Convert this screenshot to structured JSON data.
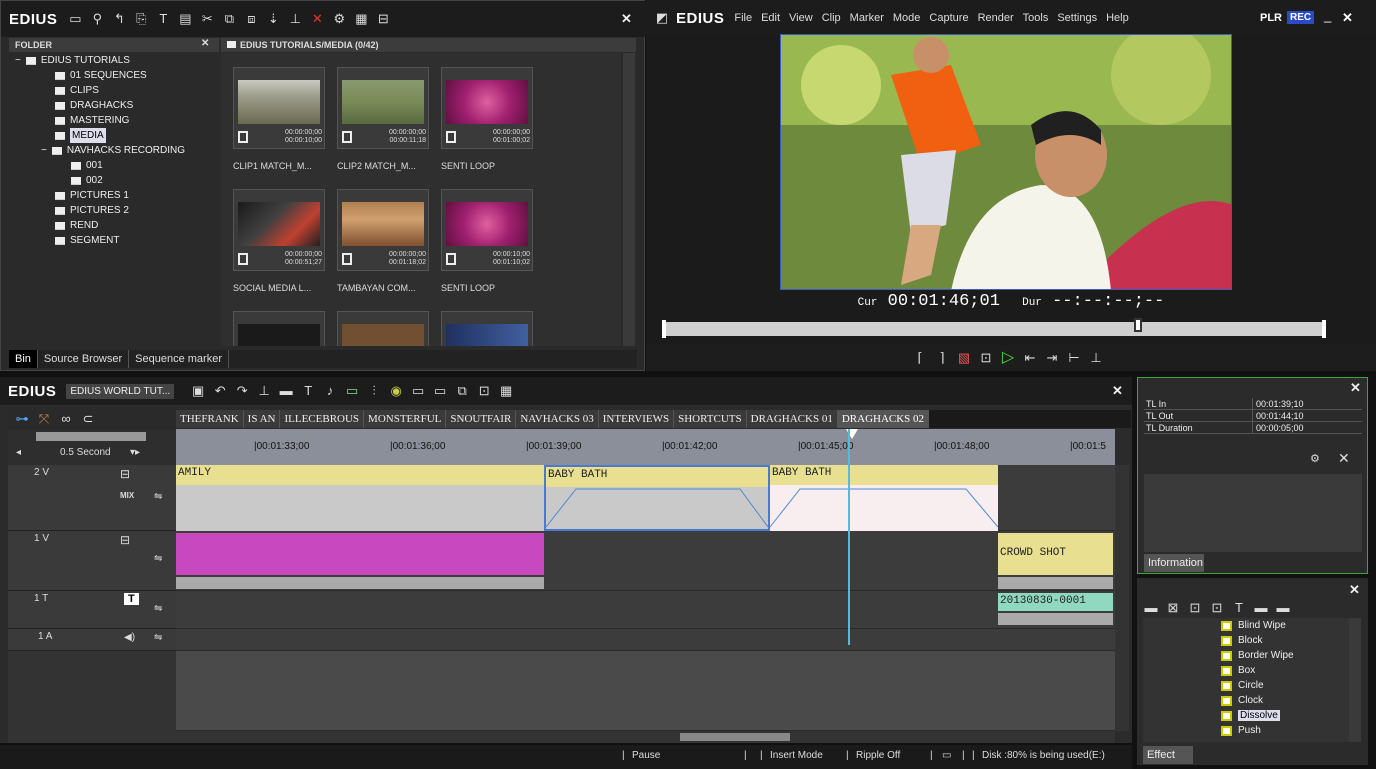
{
  "bin": {
    "app_logo": "EDIUS",
    "folder_header": "FOLDER",
    "media_header": "EDIUS TUTORIALS/MEDIA (0/42)",
    "tree": [
      {
        "label": "EDIUS TUTORIALS",
        "expander": "−"
      },
      {
        "label": "01 SEQUENCES"
      },
      {
        "label": "CLIPS"
      },
      {
        "label": "DRAGHACKS"
      },
      {
        "label": "MASTERING"
      },
      {
        "label": "MEDIA",
        "selected": true
      },
      {
        "label": "NAVHACKS RECORDING",
        "expander": "−"
      },
      {
        "label": "001"
      },
      {
        "label": "002"
      },
      {
        "label": "PICTURES 1"
      },
      {
        "label": "PICTURES 2"
      },
      {
        "label": "REND"
      },
      {
        "label": "SEGMENT"
      }
    ],
    "clips": [
      {
        "title": "CLIP1 MATCH_M...",
        "tc_in": "00:00:00;00",
        "tc_dur": "00:00:10;00"
      },
      {
        "title": "CLIP2 MATCH_M...",
        "tc_in": "00:00:00;00",
        "tc_dur": "00:00:11;18"
      },
      {
        "title": "SENTI LOOP",
        "tc_in": "00:00:00;00",
        "tc_dur": "00:01:00;02"
      },
      {
        "title": "SOCIAL MEDIA L...",
        "tc_in": "00:00:00;00",
        "tc_dur": "00:00:51;27"
      },
      {
        "title": "TAMBAYAN COM...",
        "tc_in": "00:00:00;00",
        "tc_dur": "00:01:18;02"
      },
      {
        "title": "SENTI LOOP",
        "tc_in": "00:00:10;00",
        "tc_dur": "00:01:10;02"
      }
    ],
    "tabs": [
      "Bin",
      "Source Browser",
      "Sequence marker"
    ]
  },
  "player": {
    "app_logo": "EDIUS",
    "menu": [
      "File",
      "Edit",
      "View",
      "Clip",
      "Marker",
      "Mode",
      "Capture",
      "Render",
      "Tools",
      "Settings",
      "Help"
    ],
    "plr": "PLR",
    "rec": "REC",
    "cur_label": "Cur",
    "cur_tc": "00:01:46;01",
    "dur_label": "Dur",
    "dur_tc": "--:--:--;--"
  },
  "timeline": {
    "app_logo": "EDIUS",
    "sequence_name": "EDIUS WORLD TUT...",
    "seq_tabs": [
      "THEFRANK",
      "IS AN",
      "ILLECEBROUS",
      "MONSTERFUL",
      "SNOUTFAIR",
      "NAVHACKS 03",
      "INTERVIEWS",
      "SHORTCUTS",
      "DRAGHACKS 01",
      "DRAGHACKS 02"
    ],
    "zoom_label": "0.5 Second",
    "ruler_ticks": [
      "|00:01:33;00",
      "|00:01:36;00",
      "|00:01:39;00",
      "|00:01:42;00",
      "|00:01:45;00",
      "|00:01:48;00",
      "|00:01:5"
    ],
    "tracks": [
      {
        "name": "2 V",
        "mix": "MIX"
      },
      {
        "name": "1 V"
      },
      {
        "name": "1 T"
      },
      {
        "name": "1 A"
      }
    ],
    "clips": {
      "amily": "AMILY",
      "baby1": "BABY BATH",
      "baby2": "BABY BATH",
      "crowd": "CROWD SHOT",
      "title_clip": "20130830-0001"
    }
  },
  "info": {
    "rows": [
      {
        "k": "TL In",
        "v": "00:01:39;10"
      },
      {
        "k": "TL Out",
        "v": "00:01:44;10"
      },
      {
        "k": "TL Duration",
        "v": "00:00:05;00"
      }
    ],
    "tab": "Information"
  },
  "effect": {
    "items": [
      "Blind Wipe",
      "Block",
      "Border Wipe",
      "Box",
      "Circle",
      "Clock",
      "Dissolve",
      "Push"
    ],
    "selected": "Dissolve",
    "tab": "Effect"
  },
  "status": {
    "pause": "Pause",
    "insert": "Insert Mode",
    "ripple": "Ripple Off",
    "disk": "Disk :80% is being used(E:)"
  }
}
